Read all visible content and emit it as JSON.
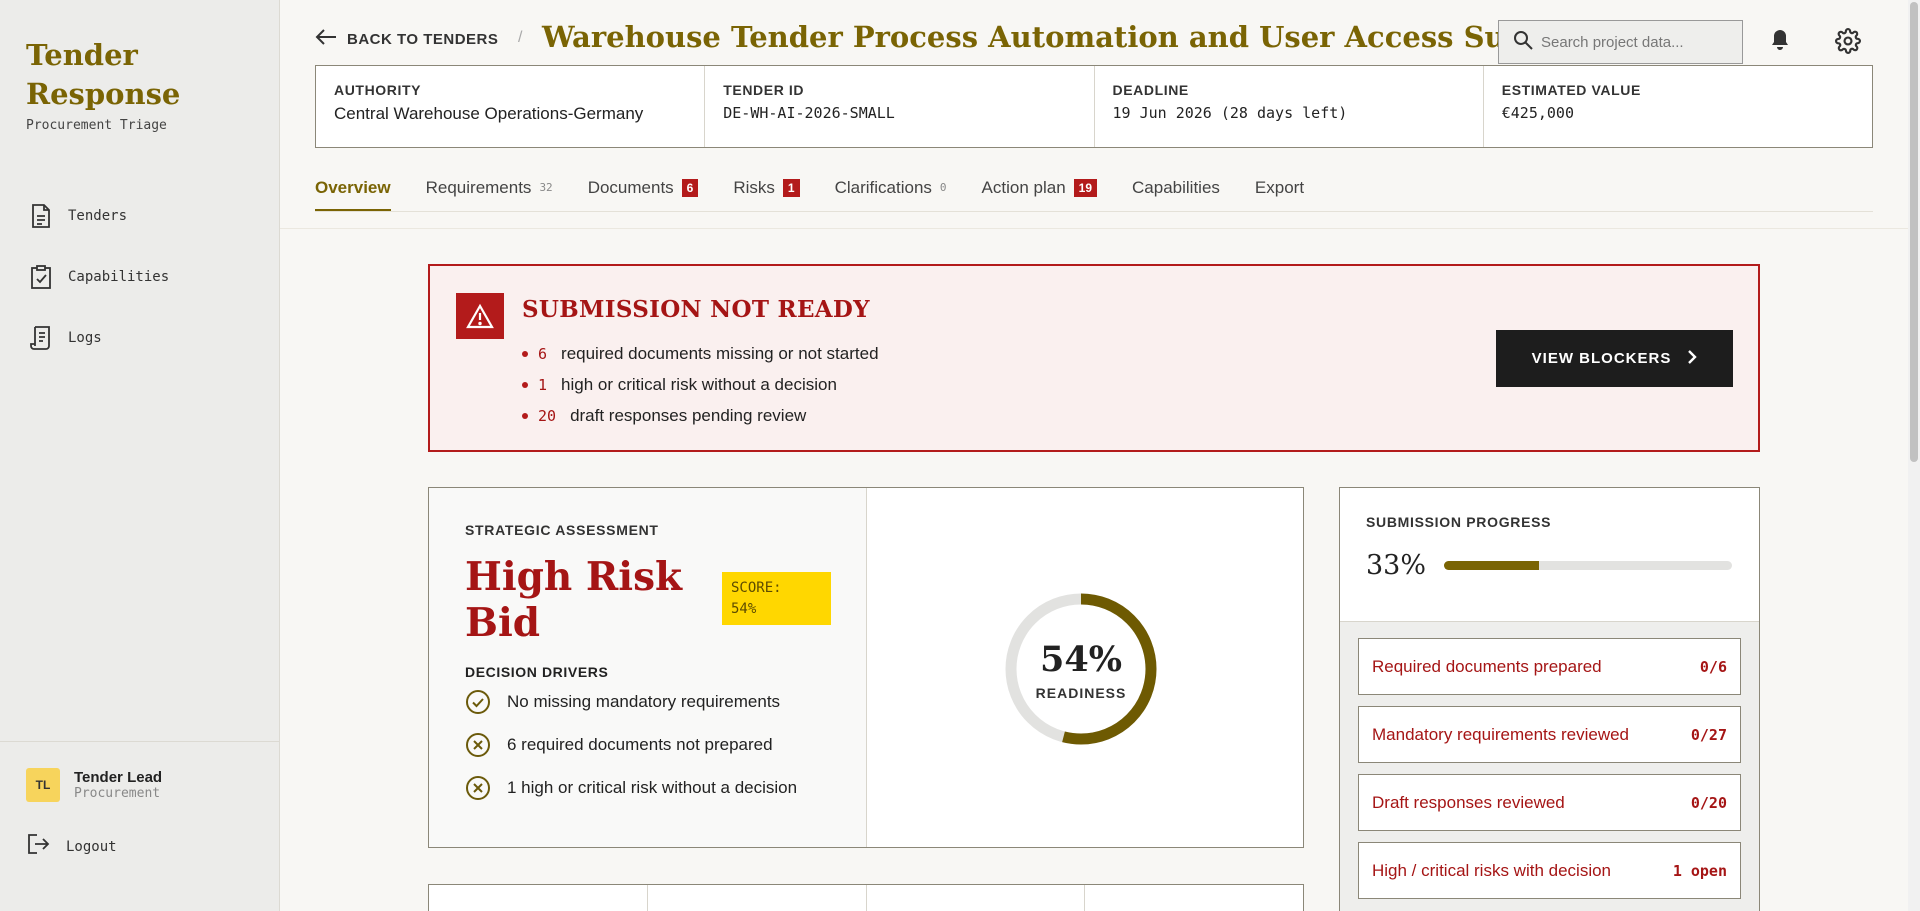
{
  "sidebar": {
    "brand_line1": "Tender",
    "brand_line2": "Response",
    "subtitle": "Procurement Triage",
    "items": [
      {
        "label": "Tenders",
        "icon": "document-icon"
      },
      {
        "label": "Capabilities",
        "icon": "clipboard-check-icon"
      },
      {
        "label": "Logs",
        "icon": "log-icon"
      }
    ],
    "user": {
      "initials": "TL",
      "name": "Tender Lead",
      "role": "Procurement"
    },
    "logout_label": "Logout"
  },
  "header": {
    "back_label": "BACK TO TENDERS",
    "separator": "/",
    "title": "Warehouse Tender Process Automation and User Access Support",
    "search_placeholder": "Search project data..."
  },
  "meta": [
    {
      "label": "AUTHORITY",
      "value": "Central Warehouse Operations-Germany"
    },
    {
      "label": "TENDER ID",
      "value": "DE-WH-AI-2026-SMALL"
    },
    {
      "label": "DEADLINE",
      "value": "19 Jun 2026 (28 days left)"
    },
    {
      "label": "ESTIMATED VALUE",
      "value": "€425,000"
    }
  ],
  "tabs": [
    {
      "label": "Overview"
    },
    {
      "label": "Requirements",
      "count": "32"
    },
    {
      "label": "Documents",
      "badge": "6"
    },
    {
      "label": "Risks",
      "badge": "1"
    },
    {
      "label": "Clarifications",
      "count": "0"
    },
    {
      "label": "Action plan",
      "badge": "19"
    },
    {
      "label": "Capabilities"
    },
    {
      "label": "Export"
    }
  ],
  "alert": {
    "title": "SUBMISSION NOT READY",
    "items": [
      {
        "num": "6",
        "text": "required documents missing or not started"
      },
      {
        "num": "1",
        "text": "high or critical risk without a decision"
      },
      {
        "num": "20",
        "text": "draft responses pending review"
      }
    ],
    "button_label": "VIEW BLOCKERS"
  },
  "strategy": {
    "label": "STRATEGIC ASSESSMENT",
    "title": "High Risk Bid",
    "score_line1": "SCORE:",
    "score_line2": "54%",
    "drivers_label": "DECISION DRIVERS",
    "drivers": [
      {
        "text": "No missing mandatory requirements",
        "status": "ok"
      },
      {
        "text": "6 required documents not prepared",
        "status": "fail"
      },
      {
        "text": "1 high or critical risk without a decision",
        "status": "fail"
      }
    ],
    "readiness_value": "54%",
    "readiness_fraction": 0.54,
    "readiness_label": "READINESS"
  },
  "progress": {
    "label": "SUBMISSION PROGRESS",
    "percent_text": "33%",
    "fraction": 0.33,
    "items": [
      {
        "label": "Required documents prepared",
        "value": "0/6"
      },
      {
        "label": "Mandatory requirements reviewed",
        "value": "0/27"
      },
      {
        "label": "Draft responses reviewed",
        "value": "0/20"
      },
      {
        "label": "High / critical risks with decision",
        "value": "1 open"
      }
    ]
  },
  "colors": {
    "accent": "#7a6404",
    "danger": "#a51515",
    "score": "#ffd700"
  }
}
